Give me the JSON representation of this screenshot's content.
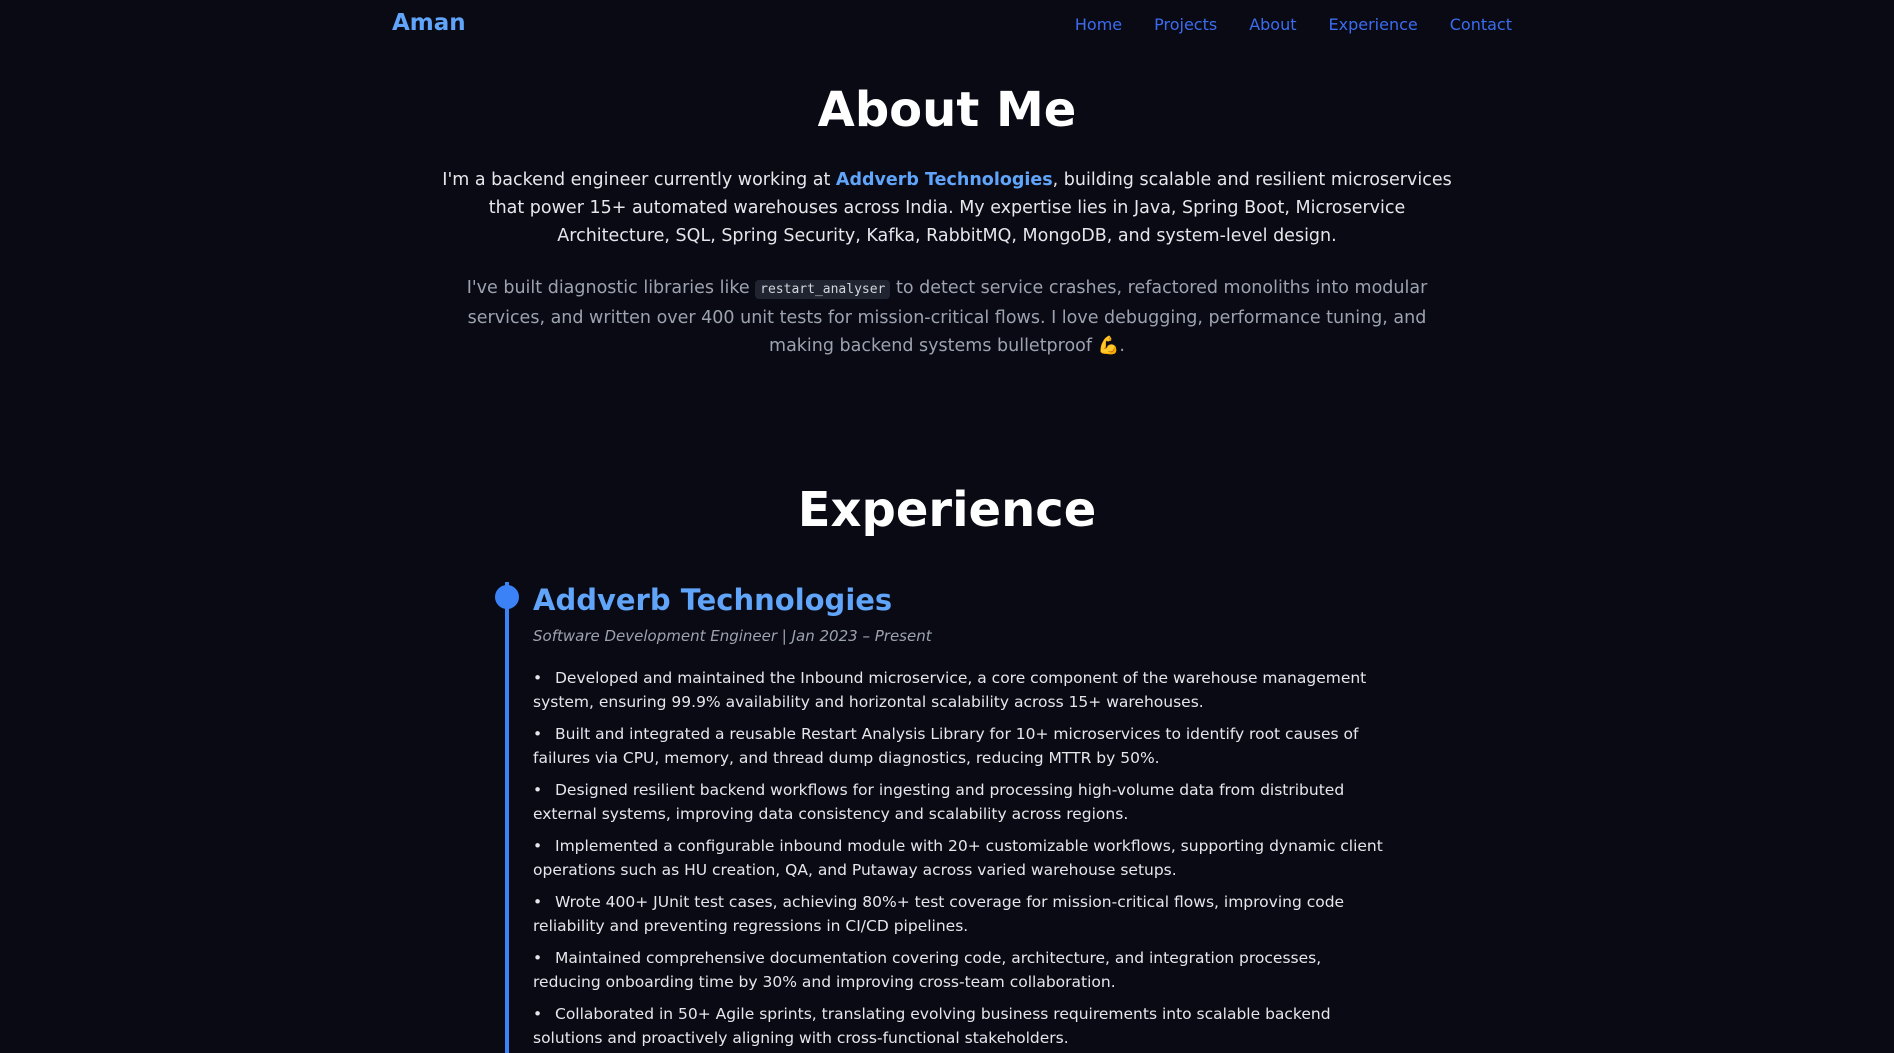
{
  "nav": {
    "brand": "Aman",
    "links": [
      "Home",
      "Projects",
      "About",
      "Experience",
      "Contact"
    ]
  },
  "about": {
    "title": "About Me",
    "p1_before": "I'm a backend engineer currently working at ",
    "p1_highlight": "Addverb Technologies",
    "p1_after": ", building scalable and resilient microservices that power 15+ automated warehouses across India. My expertise lies in Java, Spring Boot, Microservice Architecture, SQL, Spring Security, Kafka, RabbitMQ, MongoDB, and system-level design.",
    "p2_before": "I've built diagnostic libraries like ",
    "p2_code": "restart_analyser",
    "p2_after": " to detect service crashes, refactored monoliths into modular services, and written over 400 unit tests for mission-critical flows. I love debugging, performance tuning, and making backend systems bulletproof 💪."
  },
  "experience": {
    "title": "Experience",
    "jobs": [
      {
        "company": "Addverb Technologies",
        "role": "Software Development Engineer | Jan 2023 – Present",
        "bullets": [
          "Developed and maintained the Inbound microservice, a core component of the warehouse management system, ensuring 99.9% availability and horizontal scalability across 15+ warehouses.",
          "Built and integrated a reusable Restart Analysis Library for 10+ microservices to identify root causes of failures via CPU, memory, and thread dump diagnostics, reducing MTTR by 50%.",
          "Designed resilient backend workflows for ingesting and processing high-volume data from distributed external systems, improving data consistency and scalability across regions.",
          "Implemented a configurable inbound module with 20+ customizable workflows, supporting dynamic client operations such as HU creation, QA, and Putaway across varied warehouse setups.",
          "Wrote 400+ JUnit test cases, achieving 80%+ test coverage for mission-critical flows, improving code reliability and preventing regressions in CI/CD pipelines.",
          "Maintained comprehensive documentation covering code, architecture, and integration processes, reducing onboarding time by 30% and improving cross-team collaboration.",
          "Collaborated in 50+ Agile sprints, translating evolving business requirements into scalable backend solutions and proactively aligning with cross-functional stakeholders."
        ]
      }
    ]
  },
  "colors": {
    "background": "#0a0a14",
    "accent": "#60a5fa",
    "nav_link": "#3b6cf0",
    "timeline": "#3b82f6"
  }
}
